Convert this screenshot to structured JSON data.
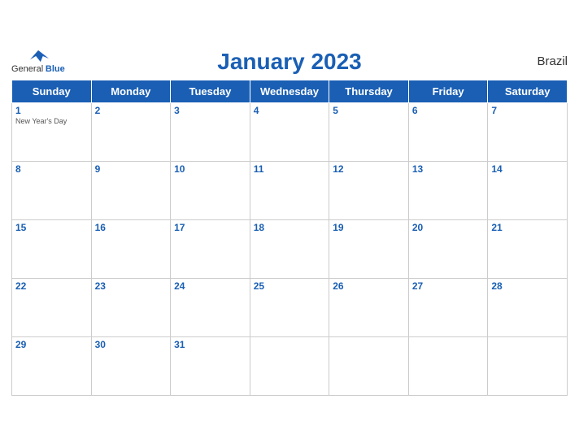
{
  "header": {
    "title": "January 2023",
    "country": "Brazil",
    "logo_general": "General",
    "logo_blue": "Blue"
  },
  "weekdays": [
    "Sunday",
    "Monday",
    "Tuesday",
    "Wednesday",
    "Thursday",
    "Friday",
    "Saturday"
  ],
  "weeks": [
    [
      {
        "day": "1",
        "holiday": "New Year's Day"
      },
      {
        "day": "2",
        "holiday": ""
      },
      {
        "day": "3",
        "holiday": ""
      },
      {
        "day": "4",
        "holiday": ""
      },
      {
        "day": "5",
        "holiday": ""
      },
      {
        "day": "6",
        "holiday": ""
      },
      {
        "day": "7",
        "holiday": ""
      }
    ],
    [
      {
        "day": "8",
        "holiday": ""
      },
      {
        "day": "9",
        "holiday": ""
      },
      {
        "day": "10",
        "holiday": ""
      },
      {
        "day": "11",
        "holiday": ""
      },
      {
        "day": "12",
        "holiday": ""
      },
      {
        "day": "13",
        "holiday": ""
      },
      {
        "day": "14",
        "holiday": ""
      }
    ],
    [
      {
        "day": "15",
        "holiday": ""
      },
      {
        "day": "16",
        "holiday": ""
      },
      {
        "day": "17",
        "holiday": ""
      },
      {
        "day": "18",
        "holiday": ""
      },
      {
        "day": "19",
        "holiday": ""
      },
      {
        "day": "20",
        "holiday": ""
      },
      {
        "day": "21",
        "holiday": ""
      }
    ],
    [
      {
        "day": "22",
        "holiday": ""
      },
      {
        "day": "23",
        "holiday": ""
      },
      {
        "day": "24",
        "holiday": ""
      },
      {
        "day": "25",
        "holiday": ""
      },
      {
        "day": "26",
        "holiday": ""
      },
      {
        "day": "27",
        "holiday": ""
      },
      {
        "day": "28",
        "holiday": ""
      }
    ],
    [
      {
        "day": "29",
        "holiday": ""
      },
      {
        "day": "30",
        "holiday": ""
      },
      {
        "day": "31",
        "holiday": ""
      },
      {
        "day": "",
        "holiday": ""
      },
      {
        "day": "",
        "holiday": ""
      },
      {
        "day": "",
        "holiday": ""
      },
      {
        "day": "",
        "holiday": ""
      }
    ]
  ],
  "colors": {
    "header_bg": "#1a5fb4",
    "accent": "#1a5fb4"
  }
}
